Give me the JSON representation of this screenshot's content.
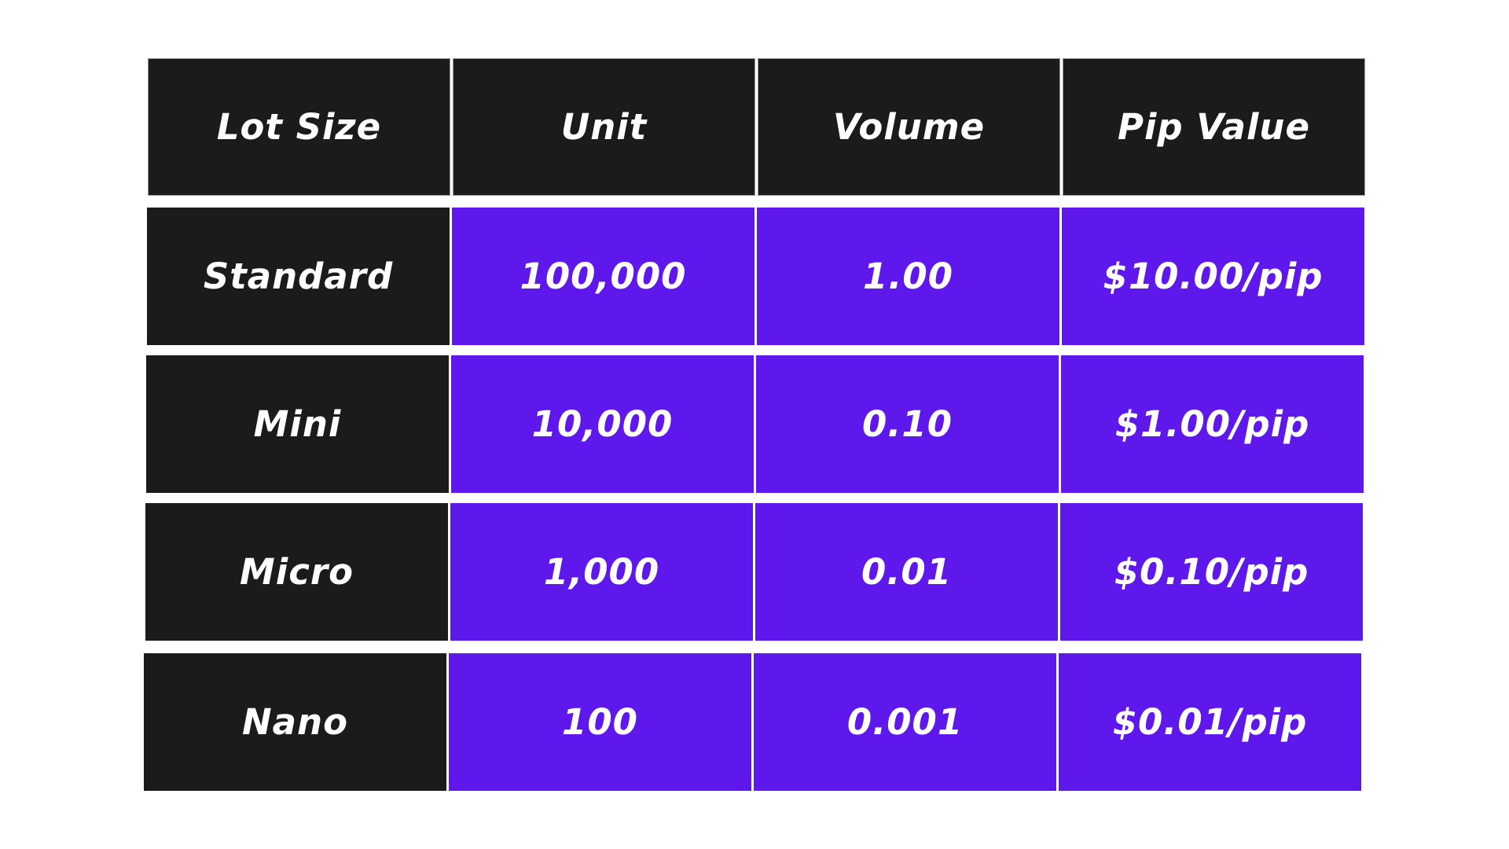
{
  "table": {
    "headers": [
      "Lot Size",
      "Unit",
      "Volume",
      "Pip Value"
    ],
    "rows": [
      [
        "Standard",
        "100,000",
        "1.00",
        "$10.00/pip"
      ],
      [
        "Mini",
        "10,000",
        "0.10",
        "$1.00/pip"
      ],
      [
        "Micro",
        "1,000",
        "0.01",
        "$0.10/pip"
      ],
      [
        "Nano",
        "100",
        "0.001",
        "$0.01/pip"
      ]
    ]
  },
  "colors": {
    "header_bg": "#1b1b1b",
    "label_bg": "#1b1b1b",
    "data_bg": "#5e18eb",
    "text": "#ffffff",
    "page_bg": "#ffffff"
  }
}
